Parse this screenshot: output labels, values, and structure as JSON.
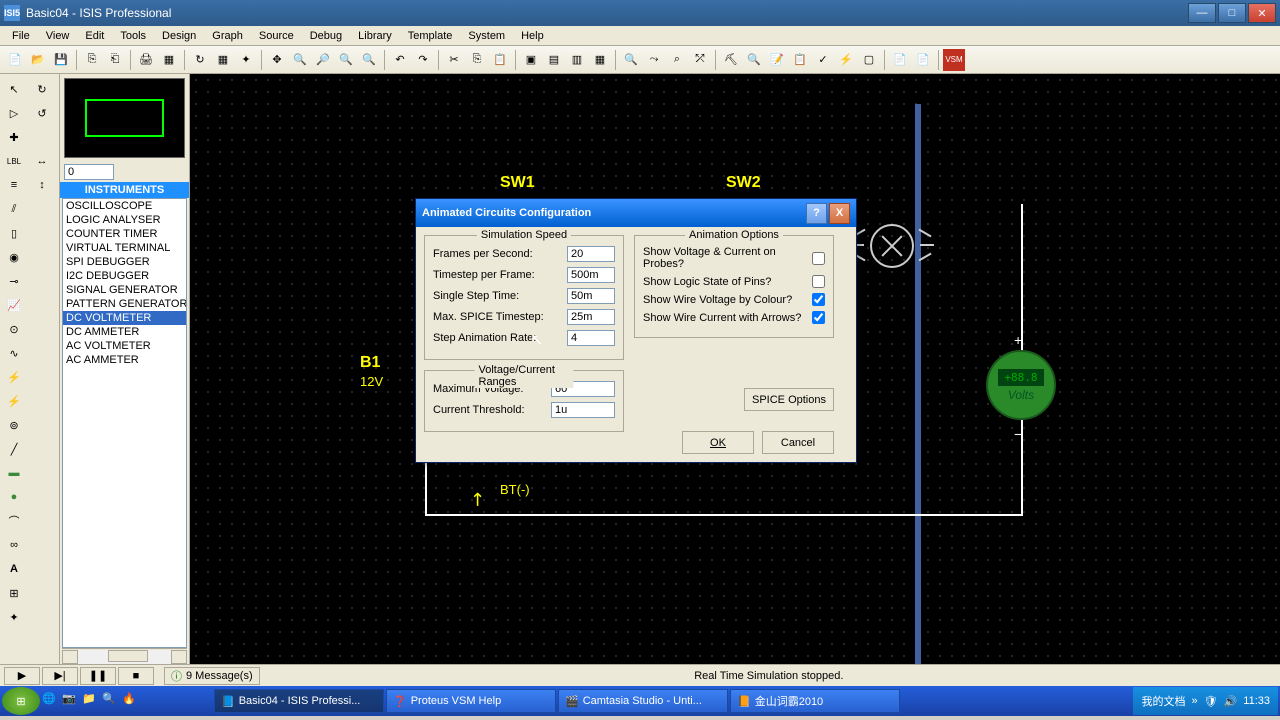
{
  "titlebar": {
    "icon_text": "ISI5",
    "title": "Basic04 - ISIS Professional"
  },
  "menus": [
    "File",
    "View",
    "Edit",
    "Tools",
    "Design",
    "Graph",
    "Source",
    "Debug",
    "Library",
    "Template",
    "System",
    "Help"
  ],
  "instruments": {
    "header": "INSTRUMENTS",
    "items": [
      "OSCILLOSCOPE",
      "LOGIC ANALYSER",
      "COUNTER TIMER",
      "VIRTUAL TERMINAL",
      "SPI DEBUGGER",
      "I2C DEBUGGER",
      "SIGNAL GENERATOR",
      "PATTERN GENERATOR",
      "DC VOLTMETER",
      "DC AMMETER",
      "AC VOLTMETER",
      "AC AMMETER"
    ],
    "selected_index": 8,
    "angle_value": "0"
  },
  "canvas": {
    "sw1": "SW1",
    "sw2": "SW2",
    "b1": "B1",
    "b1_sub": "12V",
    "bt_neg": "BT(-)",
    "voltmeter_value": "+88.8",
    "voltmeter_label": "Volts"
  },
  "transport": {
    "msg_count": "9 Message(s)",
    "status": "Real Time Simulation stopped."
  },
  "taskbar": {
    "items": [
      "Basic04 - ISIS Professi...",
      "Proteus VSM Help",
      "Camtasia Studio - Unti...",
      "金山词霸2010"
    ],
    "tray_label": "我的文档",
    "time": "11:33"
  },
  "dialog": {
    "title": "Animated Circuits Configuration",
    "sim_speed": {
      "title": "Simulation Speed",
      "fps_label": "Frames per Second:",
      "fps": "20",
      "tpf_label": "Timestep per Frame:",
      "tpf": "500m",
      "sst_label": "Single Step Time:",
      "sst": "50m",
      "mst_label": "Max. SPICE Timestep:",
      "mst": "25m",
      "sar_label": "Step Animation Rate:",
      "sar": "4"
    },
    "vc_ranges": {
      "title": "Voltage/Current Ranges",
      "mv_label": "Maximum Voltage:",
      "mv": "60",
      "ct_label": "Current Threshold:",
      "ct": "1u"
    },
    "anim_opts": {
      "title": "Animation Options",
      "opt1": "Show Voltage & Current on Probes?",
      "opt2": "Show Logic State of Pins?",
      "opt3": "Show Wire Voltage by Colour?",
      "opt4": "Show Wire Current with Arrows?"
    },
    "spice_btn": "SPICE Options",
    "ok": "OK",
    "cancel": "Cancel"
  }
}
